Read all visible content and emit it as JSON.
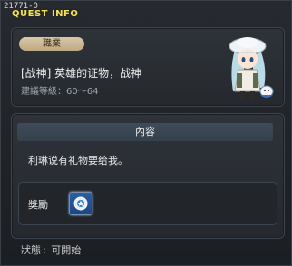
{
  "window": {
    "id_label": "21771-0",
    "title": "QUEST INFO"
  },
  "quest": {
    "job_badge": "職業",
    "name": "[战神] 英雄的证物，战神",
    "recommended_level": "建議等級：60～64"
  },
  "content": {
    "header": "內容",
    "text": "利琳说有礼物要给我。"
  },
  "reward": {
    "label": "獎勵",
    "icon": "reward-item-icon"
  },
  "status": {
    "label": "狀態",
    "value": "可開始"
  },
  "colors": {
    "title": "#f2e25a",
    "badge_bg": "#d9c7a6",
    "header_bg": "#3f4b58"
  }
}
